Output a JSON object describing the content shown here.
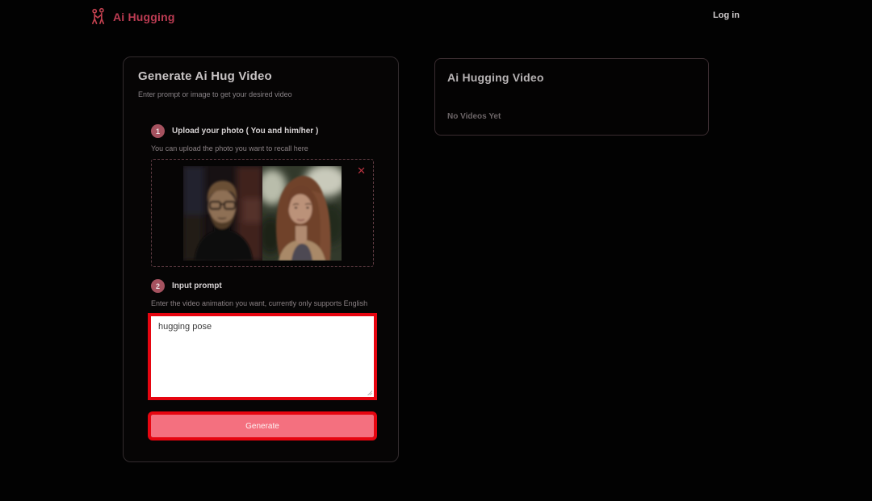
{
  "header": {
    "logo_text": "Ai Hugging",
    "login_label": "Log in"
  },
  "generator": {
    "title": "Generate Ai Hug Video",
    "subtitle": "Enter prompt or image to get your desired video",
    "step1": {
      "number": "1",
      "label": "Upload your photo ( You and him/her )",
      "description": "You can upload the photo you want to recall here"
    },
    "upload": {
      "close_icon": "✕",
      "photo_left_alt": "man-with-glasses-photo",
      "photo_right_alt": "woman-long-hair-photo"
    },
    "step2": {
      "number": "2",
      "label": "Input prompt",
      "description": "Enter the video animation you want, currently only supports English"
    },
    "prompt": {
      "value": "hugging pose"
    },
    "generate_label": "Generate"
  },
  "results": {
    "title": "Ai Hugging Video",
    "empty_message": "No Videos Yet"
  },
  "colors": {
    "accent_pink": "#bd3c53",
    "badge_rose": "#a5525f",
    "button_pink": "#f4707f",
    "annotation_red": "#e60510",
    "close_red": "#b5323f",
    "dashed_border": "#5e3b42"
  }
}
